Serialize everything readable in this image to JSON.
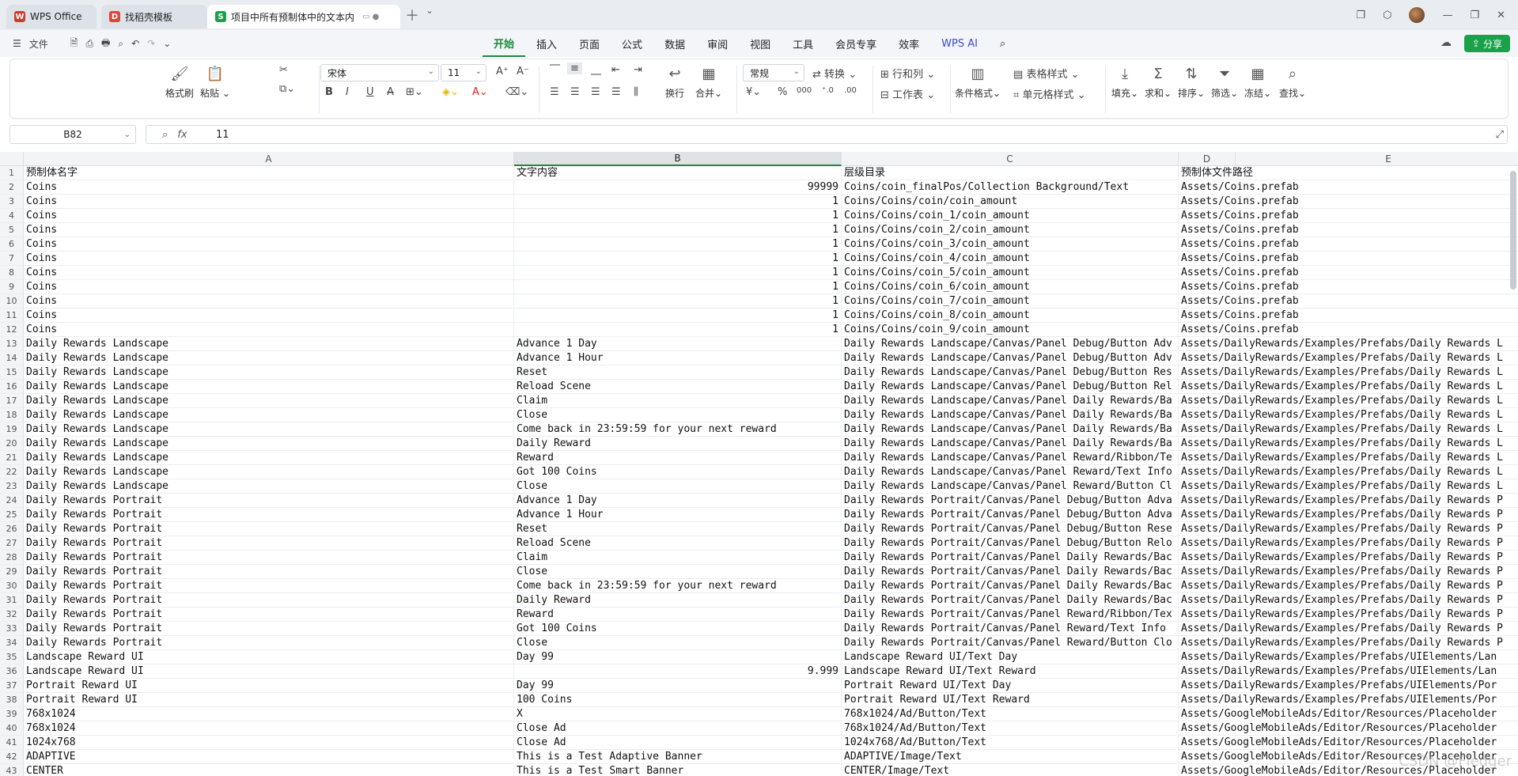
{
  "tabs": [
    {
      "label": "WPS Office",
      "badge": "W",
      "color": "#d23a2b"
    },
    {
      "label": "找稻壳模板",
      "badge": "D",
      "color": "#e0443a"
    },
    {
      "label": "项目中所有预制体中的文本内",
      "badge": "S",
      "color": "#1aa24b"
    }
  ],
  "menu_left": {
    "file": "文件"
  },
  "menu_tabs": [
    "开始",
    "插入",
    "页面",
    "公式",
    "数据",
    "审阅",
    "视图",
    "工具",
    "会员专享",
    "效率",
    "WPS AI"
  ],
  "share_label": "分享",
  "ribbon": {
    "format_painter": "格式刷",
    "paste": "粘贴",
    "font_name": "宋体",
    "font_size": "11",
    "wrap": "换行",
    "merge": "合并",
    "number_format": "常规",
    "convert": "转换",
    "rows_cols": "行和列",
    "worksheet": "工作表",
    "cond_format": "条件格式",
    "table_style": "表格样式",
    "cell_style": "单元格样式",
    "fill": "填充",
    "sum": "求和",
    "sort": "排序",
    "filter": "筛选",
    "freeze": "冻结",
    "find": "查找"
  },
  "namebox": "B82",
  "formula_value": "11",
  "columns": [
    "A",
    "B",
    "C",
    "D",
    "E"
  ],
  "rows": [
    {
      "n": "1",
      "a": "预制体名字",
      "b": "文字内容",
      "bnum": false,
      "c": "层级目录",
      "d": "预制体文件路径"
    },
    {
      "n": "2",
      "a": "Coins",
      "b": "99999",
      "bnum": true,
      "c": "Coins/coin_finalPos/Collection Background/Text",
      "d": "Assets/Coins.prefab"
    },
    {
      "n": "3",
      "a": "Coins",
      "b": "1",
      "bnum": true,
      "c": "Coins/Coins/coin/coin_amount",
      "d": "Assets/Coins.prefab"
    },
    {
      "n": "4",
      "a": "Coins",
      "b": "1",
      "bnum": true,
      "c": "Coins/Coins/coin_1/coin_amount",
      "d": "Assets/Coins.prefab"
    },
    {
      "n": "5",
      "a": "Coins",
      "b": "1",
      "bnum": true,
      "c": "Coins/Coins/coin_2/coin_amount",
      "d": "Assets/Coins.prefab"
    },
    {
      "n": "6",
      "a": "Coins",
      "b": "1",
      "bnum": true,
      "c": "Coins/Coins/coin_3/coin_amount",
      "d": "Assets/Coins.prefab"
    },
    {
      "n": "7",
      "a": "Coins",
      "b": "1",
      "bnum": true,
      "c": "Coins/Coins/coin_4/coin_amount",
      "d": "Assets/Coins.prefab"
    },
    {
      "n": "8",
      "a": "Coins",
      "b": "1",
      "bnum": true,
      "c": "Coins/Coins/coin_5/coin_amount",
      "d": "Assets/Coins.prefab"
    },
    {
      "n": "9",
      "a": "Coins",
      "b": "1",
      "bnum": true,
      "c": "Coins/Coins/coin_6/coin_amount",
      "d": "Assets/Coins.prefab"
    },
    {
      "n": "10",
      "a": "Coins",
      "b": "1",
      "bnum": true,
      "c": "Coins/Coins/coin_7/coin_amount",
      "d": "Assets/Coins.prefab"
    },
    {
      "n": "11",
      "a": "Coins",
      "b": "1",
      "bnum": true,
      "c": "Coins/Coins/coin_8/coin_amount",
      "d": "Assets/Coins.prefab"
    },
    {
      "n": "12",
      "a": "Coins",
      "b": "1",
      "bnum": true,
      "c": "Coins/Coins/coin_9/coin_amount",
      "d": "Assets/Coins.prefab"
    },
    {
      "n": "13",
      "a": "Daily Rewards Landscape",
      "b": "Advance 1 Day",
      "bnum": false,
      "c": "Daily Rewards Landscape/Canvas/Panel Debug/Button Adv",
      "d": "Assets/DailyRewards/Examples/Prefabs/Daily Rewards L"
    },
    {
      "n": "14",
      "a": "Daily Rewards Landscape",
      "b": "Advance 1 Hour",
      "bnum": false,
      "c": "Daily Rewards Landscape/Canvas/Panel Debug/Button Adv",
      "d": "Assets/DailyRewards/Examples/Prefabs/Daily Rewards L"
    },
    {
      "n": "15",
      "a": "Daily Rewards Landscape",
      "b": "Reset",
      "bnum": false,
      "c": "Daily Rewards Landscape/Canvas/Panel Debug/Button Res",
      "d": "Assets/DailyRewards/Examples/Prefabs/Daily Rewards L"
    },
    {
      "n": "16",
      "a": "Daily Rewards Landscape",
      "b": "Reload Scene",
      "bnum": false,
      "c": "Daily Rewards Landscape/Canvas/Panel Debug/Button Rel",
      "d": "Assets/DailyRewards/Examples/Prefabs/Daily Rewards L"
    },
    {
      "n": "17",
      "a": "Daily Rewards Landscape",
      "b": "Claim",
      "bnum": false,
      "c": "Daily Rewards Landscape/Canvas/Panel Daily Rewards/Ba",
      "d": "Assets/DailyRewards/Examples/Prefabs/Daily Rewards L"
    },
    {
      "n": "18",
      "a": "Daily Rewards Landscape",
      "b": "Close",
      "bnum": false,
      "c": "Daily Rewards Landscape/Canvas/Panel Daily Rewards/Ba",
      "d": "Assets/DailyRewards/Examples/Prefabs/Daily Rewards L"
    },
    {
      "n": "19",
      "a": "Daily Rewards Landscape",
      "b": "Come back in 23:59:59 for your next reward",
      "bnum": false,
      "c": "Daily Rewards Landscape/Canvas/Panel Daily Rewards/Ba",
      "d": "Assets/DailyRewards/Examples/Prefabs/Daily Rewards L"
    },
    {
      "n": "20",
      "a": "Daily Rewards Landscape",
      "b": "Daily Reward",
      "bnum": false,
      "c": "Daily Rewards Landscape/Canvas/Panel Daily Rewards/Ba",
      "d": "Assets/DailyRewards/Examples/Prefabs/Daily Rewards L"
    },
    {
      "n": "21",
      "a": "Daily Rewards Landscape",
      "b": "Reward",
      "bnum": false,
      "c": "Daily Rewards Landscape/Canvas/Panel Reward/Ribbon/Te",
      "d": "Assets/DailyRewards/Examples/Prefabs/Daily Rewards L"
    },
    {
      "n": "22",
      "a": "Daily Rewards Landscape",
      "b": "Got 100 Coins",
      "bnum": false,
      "c": "Daily Rewards Landscape/Canvas/Panel Reward/Text Info",
      "d": "Assets/DailyRewards/Examples/Prefabs/Daily Rewards L"
    },
    {
      "n": "23",
      "a": "Daily Rewards Landscape",
      "b": "Close",
      "bnum": false,
      "c": "Daily Rewards Landscape/Canvas/Panel Reward/Button Cl",
      "d": "Assets/DailyRewards/Examples/Prefabs/Daily Rewards L"
    },
    {
      "n": "24",
      "a": "Daily Rewards Portrait",
      "b": "Advance 1 Day",
      "bnum": false,
      "c": "Daily Rewards Portrait/Canvas/Panel Debug/Button Adva",
      "d": "Assets/DailyRewards/Examples/Prefabs/Daily Rewards P"
    },
    {
      "n": "25",
      "a": "Daily Rewards Portrait",
      "b": "Advance 1 Hour",
      "bnum": false,
      "c": "Daily Rewards Portrait/Canvas/Panel Debug/Button Adva",
      "d": "Assets/DailyRewards/Examples/Prefabs/Daily Rewards P"
    },
    {
      "n": "26",
      "a": "Daily Rewards Portrait",
      "b": "Reset",
      "bnum": false,
      "c": "Daily Rewards Portrait/Canvas/Panel Debug/Button Rese",
      "d": "Assets/DailyRewards/Examples/Prefabs/Daily Rewards P"
    },
    {
      "n": "27",
      "a": "Daily Rewards Portrait",
      "b": "Reload Scene",
      "bnum": false,
      "c": "Daily Rewards Portrait/Canvas/Panel Debug/Button Relo",
      "d": "Assets/DailyRewards/Examples/Prefabs/Daily Rewards P"
    },
    {
      "n": "28",
      "a": "Daily Rewards Portrait",
      "b": "Claim",
      "bnum": false,
      "c": "Daily Rewards Portrait/Canvas/Panel Daily Rewards/Bac",
      "d": "Assets/DailyRewards/Examples/Prefabs/Daily Rewards P"
    },
    {
      "n": "29",
      "a": "Daily Rewards Portrait",
      "b": "Close",
      "bnum": false,
      "c": "Daily Rewards Portrait/Canvas/Panel Daily Rewards/Bac",
      "d": "Assets/DailyRewards/Examples/Prefabs/Daily Rewards P"
    },
    {
      "n": "30",
      "a": "Daily Rewards Portrait",
      "b": "Come back in 23:59:59 for your next reward",
      "bnum": false,
      "c": "Daily Rewards Portrait/Canvas/Panel Daily Rewards/Bac",
      "d": "Assets/DailyRewards/Examples/Prefabs/Daily Rewards P"
    },
    {
      "n": "31",
      "a": "Daily Rewards Portrait",
      "b": "Daily Reward",
      "bnum": false,
      "c": "Daily Rewards Portrait/Canvas/Panel Daily Rewards/Bac",
      "d": "Assets/DailyRewards/Examples/Prefabs/Daily Rewards P"
    },
    {
      "n": "32",
      "a": "Daily Rewards Portrait",
      "b": "Reward",
      "bnum": false,
      "c": "Daily Rewards Portrait/Canvas/Panel Reward/Ribbon/Tex",
      "d": "Assets/DailyRewards/Examples/Prefabs/Daily Rewards P"
    },
    {
      "n": "33",
      "a": "Daily Rewards Portrait",
      "b": "Got 100 Coins",
      "bnum": false,
      "c": "Daily Rewards Portrait/Canvas/Panel Reward/Text Info",
      "d": "Assets/DailyRewards/Examples/Prefabs/Daily Rewards P"
    },
    {
      "n": "34",
      "a": "Daily Rewards Portrait",
      "b": "Close",
      "bnum": false,
      "c": "Daily Rewards Portrait/Canvas/Panel Reward/Button Clo",
      "d": "Assets/DailyRewards/Examples/Prefabs/Daily Rewards P"
    },
    {
      "n": "35",
      "a": "Landscape Reward UI",
      "b": "Day 99",
      "bnum": false,
      "c": "Landscape Reward UI/Text Day",
      "d": "Assets/DailyRewards/Examples/Prefabs/UIElements/Lan"
    },
    {
      "n": "36",
      "a": "Landscape Reward UI",
      "b": "9.999",
      "bnum": true,
      "c": "Landscape Reward UI/Text Reward",
      "d": "Assets/DailyRewards/Examples/Prefabs/UIElements/Lan"
    },
    {
      "n": "37",
      "a": "Portrait Reward UI",
      "b": "Day 99",
      "bnum": false,
      "c": "Portrait Reward UI/Text Day",
      "d": "Assets/DailyRewards/Examples/Prefabs/UIElements/Por"
    },
    {
      "n": "38",
      "a": "Portrait Reward UI",
      "b": "100 Coins",
      "bnum": false,
      "c": "Portrait Reward UI/Text Reward",
      "d": "Assets/DailyRewards/Examples/Prefabs/UIElements/Por"
    },
    {
      "n": "39",
      "a": "768x1024",
      "b": "X",
      "bnum": false,
      "c": "768x1024/Ad/Button/Text",
      "d": "Assets/GoogleMobileAds/Editor/Resources/Placeholder"
    },
    {
      "n": "40",
      "a": "768x1024",
      "b": "Close Ad",
      "bnum": false,
      "c": "768x1024/Ad/Button/Text",
      "d": "Assets/GoogleMobileAds/Editor/Resources/Placeholder"
    },
    {
      "n": "41",
      "a": "1024x768",
      "b": "Close Ad",
      "bnum": false,
      "c": "1024x768/Ad/Button/Text",
      "d": "Assets/GoogleMobileAds/Editor/Resources/Placeholder"
    },
    {
      "n": "42",
      "a": "ADAPTIVE",
      "b": "This is a Test Adaptive Banner",
      "bnum": false,
      "c": "ADAPTIVE/Image/Text",
      "d": "Assets/GoogleMobileAds/Editor/Resources/Placeholder"
    },
    {
      "n": "43",
      "a": "CENTER",
      "b": "This is a Test Smart Banner",
      "bnum": false,
      "c": "CENTER/Image/Text",
      "d": "Assets/GoogleMobileAds/Editor/Resources/Placeholder"
    }
  ],
  "watermark": "CSDN @Fledger"
}
